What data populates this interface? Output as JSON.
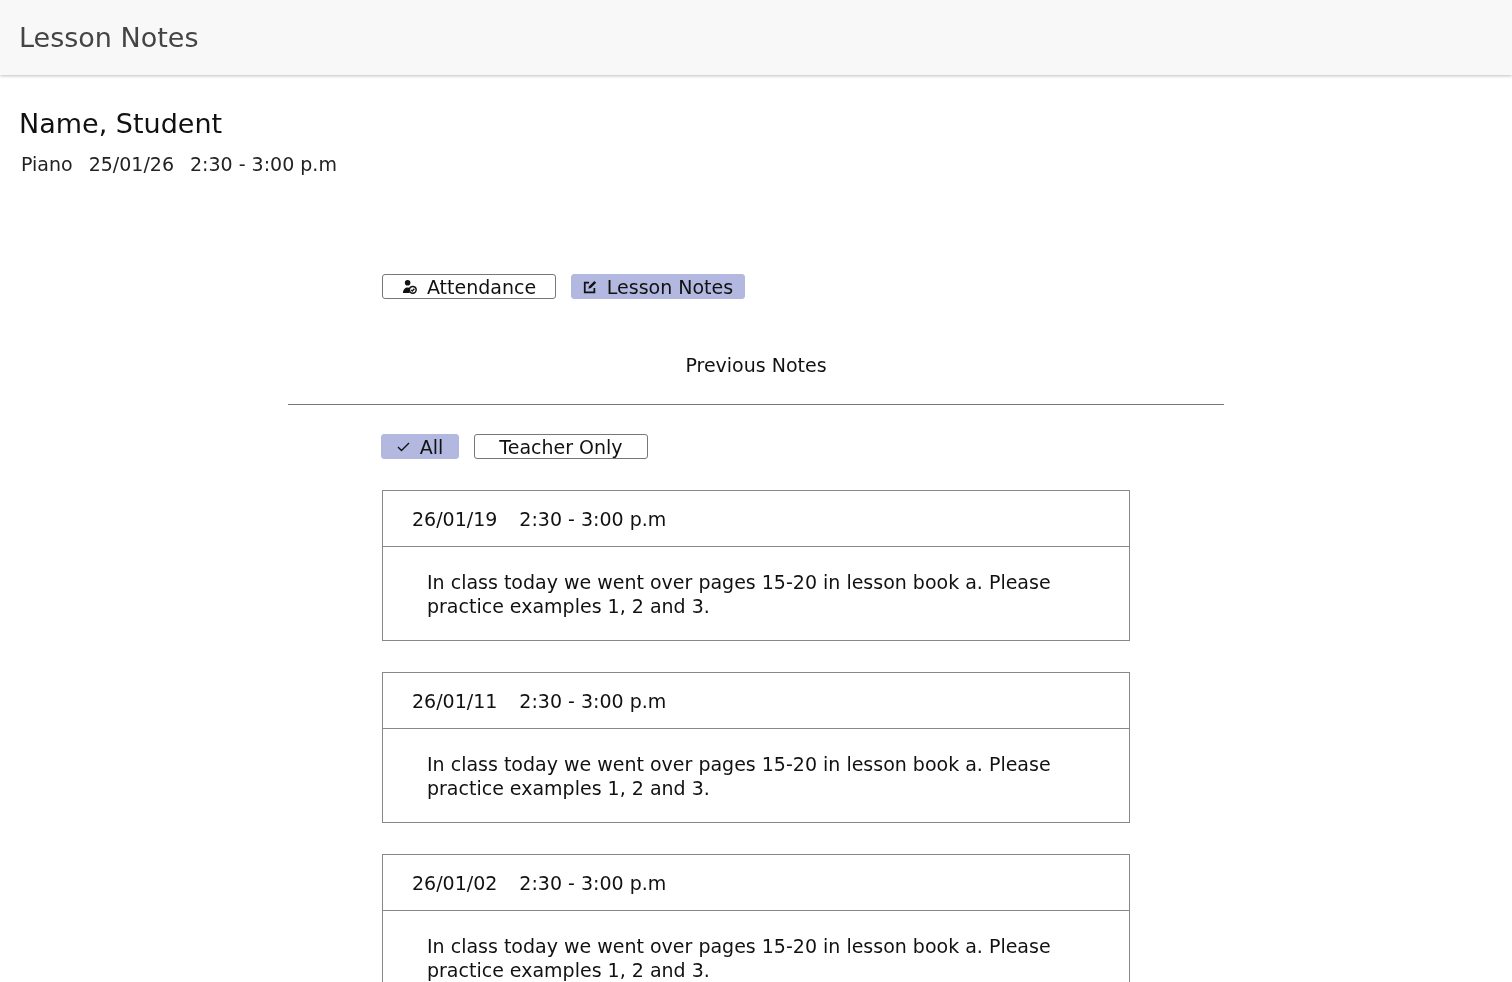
{
  "header": {
    "title": "Lesson Notes"
  },
  "student": {
    "name": "Name, Student",
    "details": [
      "Piano",
      "25/01/26",
      "2:30 - 3:00 p.m"
    ]
  },
  "tabs": [
    {
      "label": "Attendance",
      "kind": "attendance",
      "selected": false
    },
    {
      "label": "Lesson Notes",
      "kind": "notes",
      "selected": true
    }
  ],
  "section_title": "Previous Notes",
  "filters": [
    {
      "label": "All",
      "selected": true
    },
    {
      "label": "Teacher Only",
      "selected": false
    }
  ],
  "notes": [
    {
      "date": "26/01/19",
      "time": "2:30 - 3:00 p.m",
      "text": "In class today we went over pages 15-20 in lesson book a. Please practice examples 1, 2 and 3."
    },
    {
      "date": "26/01/11",
      "time": "2:30 - 3:00 p.m",
      "text": "In class today we went over pages 15-20 in lesson book a. Please practice examples 1, 2 and 3."
    },
    {
      "date": "26/01/02",
      "time": "2:30 - 3:00 p.m",
      "text": "In class today we went over pages 15-20 in lesson book a. Please practice examples 1, 2 and 3."
    }
  ]
}
